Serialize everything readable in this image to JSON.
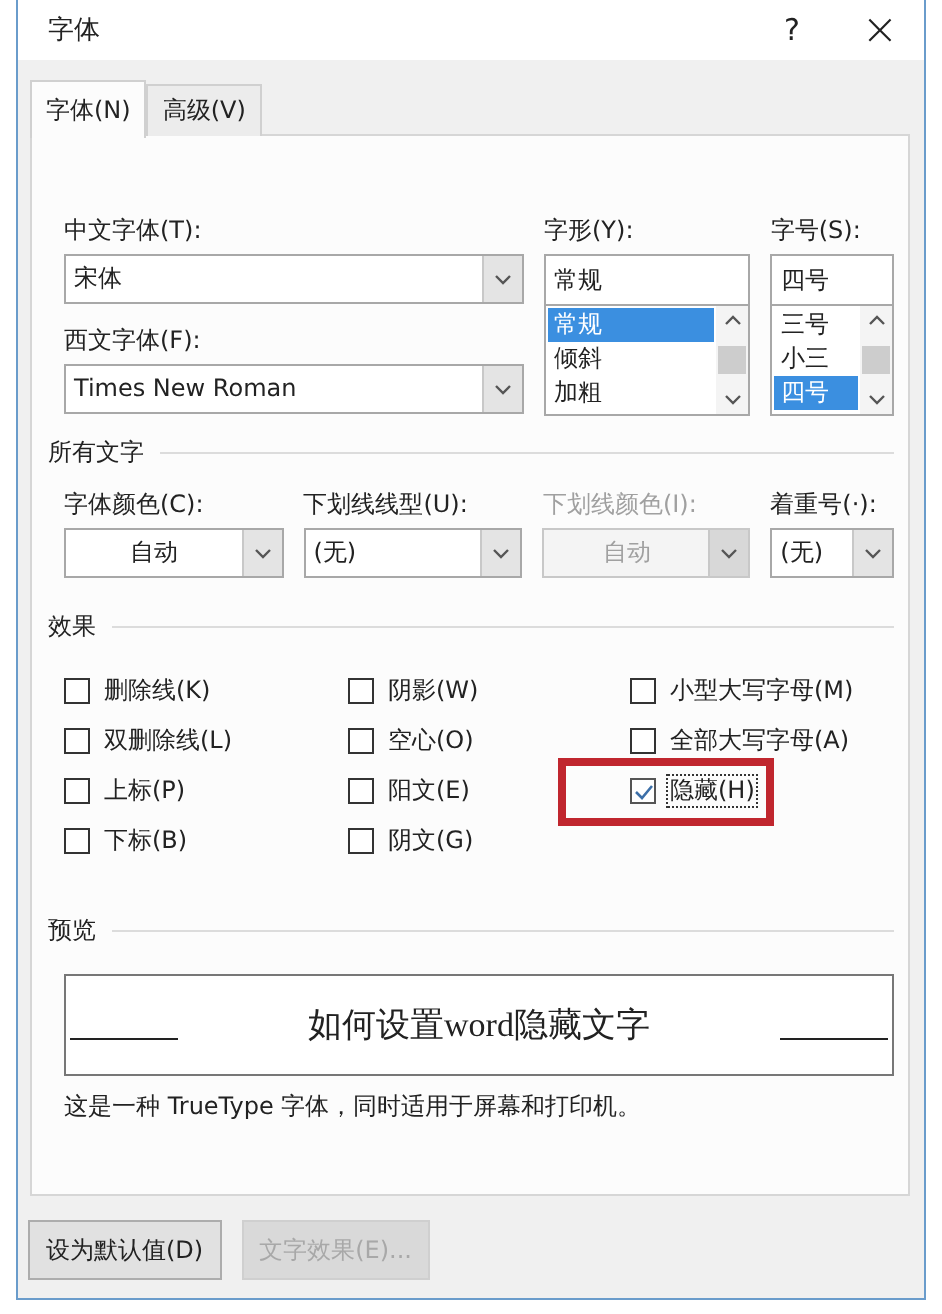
{
  "window": {
    "title": "字体",
    "help": "?",
    "close": "×"
  },
  "tabs": [
    {
      "label": "字体(N)",
      "selected": true
    },
    {
      "label": "高级(V)",
      "selected": false
    }
  ],
  "font": {
    "chinese": {
      "label": "中文字体(T):",
      "value": "宋体"
    },
    "western": {
      "label": "西文字体(F):",
      "value": "Times New Roman"
    },
    "style": {
      "label": "字形(Y):",
      "value": "常规",
      "options": [
        {
          "label": "常规",
          "selected": true
        },
        {
          "label": "倾斜",
          "selected": false
        },
        {
          "label": "加粗",
          "selected": false
        }
      ]
    },
    "size": {
      "label": "字号(S):",
      "value": "四号",
      "options": [
        {
          "label": "三号",
          "selected": false
        },
        {
          "label": "小三",
          "selected": false
        },
        {
          "label": "四号",
          "selected": true
        }
      ]
    }
  },
  "all_text": {
    "title": "所有文字",
    "fields": [
      {
        "label": "字体颜色(C):",
        "value": "自动",
        "kind": "color",
        "disabled": false
      },
      {
        "label": "下划线线型(U):",
        "value": "(无)",
        "kind": "dropdown",
        "disabled": false
      },
      {
        "label": "下划线颜色(I):",
        "value": "自动",
        "kind": "color",
        "disabled": true
      },
      {
        "label": "着重号(·):",
        "value": "(无)",
        "kind": "dropdown",
        "disabled": false
      }
    ]
  },
  "effects": {
    "title": "效果",
    "columns": [
      [
        {
          "label": "删除线(K)",
          "checked": false,
          "focused": false,
          "highlighted": false
        },
        {
          "label": "双删除线(L)",
          "checked": false,
          "focused": false,
          "highlighted": false
        },
        {
          "label": "上标(P)",
          "checked": false,
          "focused": false,
          "highlighted": false
        },
        {
          "label": "下标(B)",
          "checked": false,
          "focused": false,
          "highlighted": false
        }
      ],
      [
        {
          "label": "阴影(W)",
          "checked": false,
          "focused": false,
          "highlighted": false
        },
        {
          "label": "空心(O)",
          "checked": false,
          "focused": false,
          "highlighted": false
        },
        {
          "label": "阳文(E)",
          "checked": false,
          "focused": false,
          "highlighted": false
        },
        {
          "label": "阴文(G)",
          "checked": false,
          "focused": false,
          "highlighted": false
        }
      ],
      [
        {
          "label": "小型大写字母(M)",
          "checked": false,
          "focused": false,
          "highlighted": false
        },
        {
          "label": "全部大写字母(A)",
          "checked": false,
          "focused": false,
          "highlighted": false
        },
        {
          "label": "隐藏(H)",
          "checked": true,
          "focused": true,
          "highlighted": true
        }
      ]
    ]
  },
  "preview": {
    "title": "预览",
    "sample": "如何设置word隐藏文字",
    "note": "这是一种 TrueType 字体，同时适用于屏幕和打印机。"
  },
  "buttons": [
    {
      "label": "设为默认值(D)",
      "disabled": false
    },
    {
      "label": "文字效果(E)...",
      "disabled": true
    }
  ]
}
